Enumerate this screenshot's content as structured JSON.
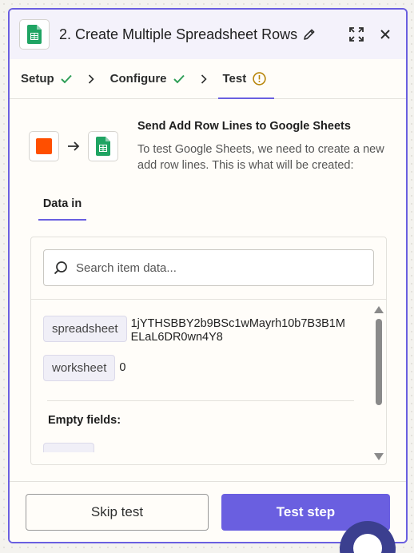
{
  "header": {
    "title": "2. Create Multiple Spreadsheet Rows",
    "app_icon": "google-sheets-icon",
    "edit_icon": "pencil-icon",
    "expand_icon": "expand-icon",
    "close_icon": "close-icon"
  },
  "tabs": [
    {
      "label": "Setup",
      "status": "complete"
    },
    {
      "label": "Configure",
      "status": "complete"
    },
    {
      "label": "Test",
      "status": "warning"
    }
  ],
  "intro": {
    "title": "Send Add Row Lines to Google Sheets",
    "description": "To test Google Sheets, we need to create a new add row lines. This is what will be created:"
  },
  "data_in": {
    "tab_label": "Data in",
    "search_placeholder": "Search item data...",
    "fields": [
      {
        "key": "spreadsheet",
        "value": "1jYTHSBBY2b9BSc1wMayrh10b7B3B1MELaL6DR0wn4Y8"
      },
      {
        "key": "worksheet",
        "value": "0"
      }
    ],
    "empty_fields_title": "Empty fields:"
  },
  "footer": {
    "skip_label": "Skip test",
    "test_label": "Test step"
  },
  "colors": {
    "accent": "#6a5fe0",
    "success": "#2e9e57",
    "warning": "#b8860b",
    "sheets_green": "#1fa463",
    "trigger_orange": "#ff4f00"
  }
}
